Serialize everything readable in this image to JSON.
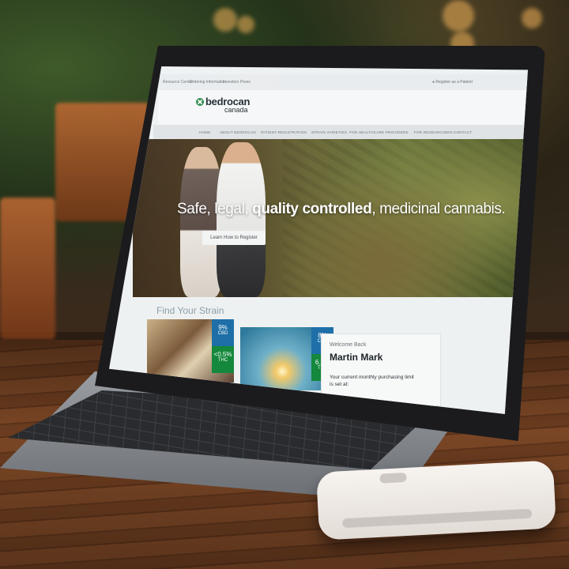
{
  "colors": {
    "nav_bg": "#dfe3e5",
    "header_bg": "#f6f7f8",
    "cbd_badge": "#1e6fa8",
    "thc_badge": "#14883c",
    "strain_title": "#8d9ea6"
  },
  "topbar": {
    "links": [
      "Resource Center",
      "Ordering Information",
      "Investors",
      "Press"
    ],
    "register": "Register as a Patient"
  },
  "header": {
    "logo_name": "bedrocan",
    "logo_sub": "canada",
    "logo_mark": "x-logo-icon"
  },
  "nav": {
    "items": [
      "HOME",
      "ABOUT BEDROCAN",
      "PATIENT REGISTRATION",
      "STRAIN VARIETIES",
      "FOR HEALTHCARE PROVIDERS",
      "FOR RESEARCHERS",
      "CONTACT"
    ]
  },
  "hero": {
    "title_pre": "Safe, legal, ",
    "title_bold": "quality controlled",
    "title_post": ", medicinal cannabis.",
    "button": "Learn How to Register"
  },
  "strains": {
    "title": "Find Your Strain",
    "cards": [
      {
        "cbd": "9%",
        "cbd_label": "CBD",
        "thc": "<0.5%",
        "thc_label": "THC"
      },
      {
        "cbd": "8%",
        "cbd_label": "CBD",
        "thc": "6.5%",
        "thc_label": "THC"
      }
    ]
  },
  "welcome": {
    "greeting": "Welcome Back",
    "name": "Martin Mark",
    "message": "Your current monthly purchasing limit is set at:"
  }
}
